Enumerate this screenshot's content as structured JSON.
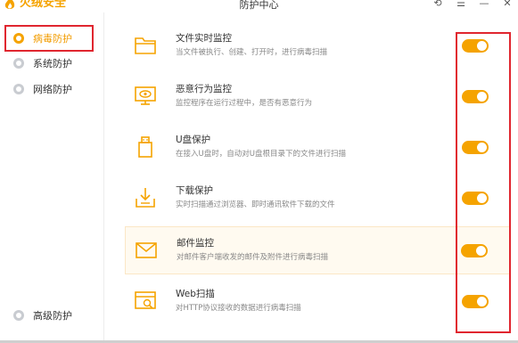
{
  "app": {
    "name": "火绒安全",
    "window_title": "防护中心",
    "accent_color": "#f5a300",
    "annotation_color": "#e0262f"
  },
  "window_controls": [
    {
      "name": "back-icon",
      "glyph": "⟲"
    },
    {
      "name": "menu-icon",
      "glyph": "☰"
    },
    {
      "name": "minimize-icon",
      "glyph": "—"
    },
    {
      "name": "close-icon",
      "glyph": "✕"
    }
  ],
  "sidebar": {
    "items": [
      {
        "label": "病毒防护",
        "icon": "virus-shield-icon",
        "active": true
      },
      {
        "label": "系统防护",
        "icon": "system-shield-icon",
        "active": false
      },
      {
        "label": "网络防护",
        "icon": "globe-icon",
        "active": false
      }
    ],
    "bottom_item": {
      "label": "高级防护",
      "icon": "advanced-shield-icon"
    }
  },
  "features": [
    {
      "title": "文件实时监控",
      "desc": "当文件被执行、创建、打开时，进行病毒扫描",
      "icon": "folder-icon",
      "enabled": true
    },
    {
      "title": "恶意行为监控",
      "desc": "监控程序在运行过程中，是否有恶意行为",
      "icon": "monitor-eye-icon",
      "enabled": true
    },
    {
      "title": "U盘保护",
      "desc": "在接入U盘时，自动对U盘根目录下的文件进行扫描",
      "icon": "usb-drive-icon",
      "enabled": true
    },
    {
      "title": "下载保护",
      "desc": "实时扫描通过浏览器、即时通讯软件下载的文件",
      "icon": "download-tray-icon",
      "enabled": true
    },
    {
      "title": "邮件监控",
      "desc": "对邮件客户端收发的邮件及附件进行病毒扫描",
      "icon": "mail-icon",
      "enabled": true
    },
    {
      "title": "Web扫描",
      "desc": "对HTTP协议接收的数据进行病毒扫描",
      "icon": "web-scan-icon",
      "enabled": true
    }
  ]
}
